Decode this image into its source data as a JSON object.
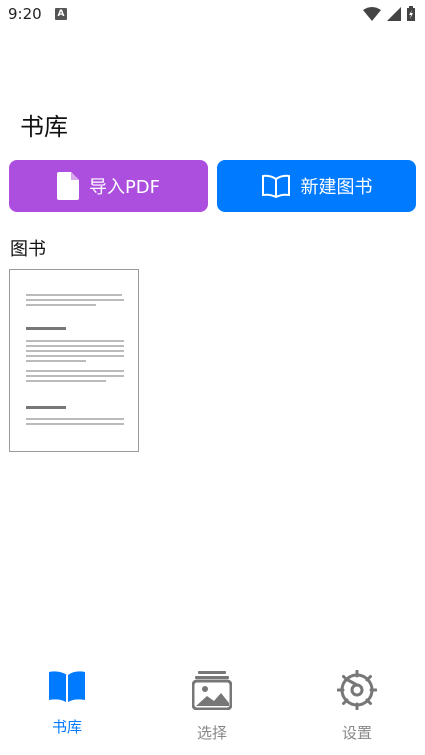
{
  "status_bar": {
    "time": "9:20",
    "notification_letter": "A"
  },
  "page": {
    "title": "书库"
  },
  "actions": {
    "import_label": "导入PDF",
    "new_label": "新建图书"
  },
  "books_section": {
    "title": "图书"
  },
  "tabs": [
    {
      "label": "书库",
      "icon": "book-icon",
      "active": true
    },
    {
      "label": "选择",
      "icon": "image-icon",
      "active": false
    },
    {
      "label": "设置",
      "icon": "gear-icon",
      "active": false
    }
  ],
  "colors": {
    "accent": "#007aff",
    "import": "#ad4fde",
    "inactive": "#888888"
  }
}
